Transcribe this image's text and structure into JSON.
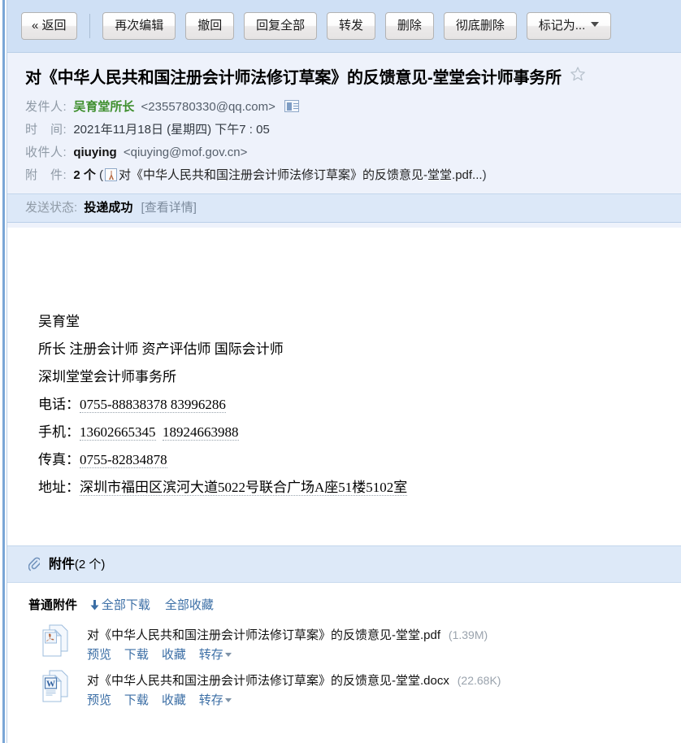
{
  "toolbar": {
    "buttons": [
      {
        "label": "« 返回",
        "name": "back-button",
        "has_caret": false
      },
      {
        "label": "再次编辑",
        "name": "edit-again-button",
        "has_caret": false
      },
      {
        "label": "撤回",
        "name": "recall-button",
        "has_caret": false
      },
      {
        "label": "回复全部",
        "name": "reply-all-button",
        "has_caret": false
      },
      {
        "label": "转发",
        "name": "forward-button",
        "has_caret": false
      },
      {
        "label": "删除",
        "name": "delete-button",
        "has_caret": false
      },
      {
        "label": "彻底删除",
        "name": "delete-permanently-button",
        "has_caret": false
      },
      {
        "label": "标记为...",
        "name": "mark-as-button",
        "has_caret": true
      }
    ]
  },
  "mail": {
    "subject": "对《中华人民共和国注册会计师法修订草案》的反馈意见-堂堂会计师事务所",
    "from_label": "发件人:",
    "from_name": "吴育堂所长",
    "from_address": "<2355780330@qq.com>",
    "time_label": "时　间:",
    "time_value": "2021年11月18日 (星期四) 下午7 : 05",
    "to_label": "收件人:",
    "to_name": "qiuying",
    "to_address": "<qiuying@mof.gov.cn>",
    "attach_label": "附　件:",
    "attach_count": "2 个",
    "attach_inline_open": "(",
    "attach_inline_name": "对《中华人民共和国注册会计师法修订草案》的反馈意见-堂堂.pdf...",
    "attach_inline_close": ")",
    "status_label": "发送状态:",
    "status_value": "投递成功",
    "status_link": "[查看详情]"
  },
  "signature": {
    "lines": [
      "吴育堂",
      "所长  注册会计师  资产评估师  国际会计师",
      "深圳堂堂会计师事务所"
    ],
    "phone_label": "电话：",
    "phone_value": "0755-88838378 83996286",
    "mobile_label": "手机：",
    "mobile_value_1": "13602665345",
    "mobile_value_2": "18924663988",
    "fax_label": "传真：",
    "fax_value": "0755-82834878",
    "address_label": "地址：",
    "address_value": "深圳市福田区滨河大道5022号联合广场A座51楼5102室"
  },
  "attachments": {
    "panel_title": "附件",
    "panel_count": "(2 个)",
    "group_label": "普通附件",
    "download_all": "全部下载",
    "favorite_all": "全部收藏",
    "ops": {
      "preview": "预览",
      "download": "下载",
      "favorite": "收藏",
      "save_to": "转存"
    },
    "items": [
      {
        "name": "对《中华人民共和国注册会计师法修订草案》的反馈意见-堂堂.pdf",
        "size": "(1.39M)",
        "type": "pdf"
      },
      {
        "name": "对《中华人民共和国注册会计师法修订草案》的反馈意见-堂堂.docx",
        "size": "(22.68K)",
        "type": "docx"
      }
    ]
  },
  "colors": {
    "toolbar_bg": "#cfe0f5",
    "header_bg": "#eef2fb",
    "status_bg": "#dce8f8",
    "attachment_bar_bg": "#dde9f8",
    "link": "#3b6ea5",
    "sender_name": "#3f8f2e",
    "label_gray": "#8f9aa6"
  }
}
